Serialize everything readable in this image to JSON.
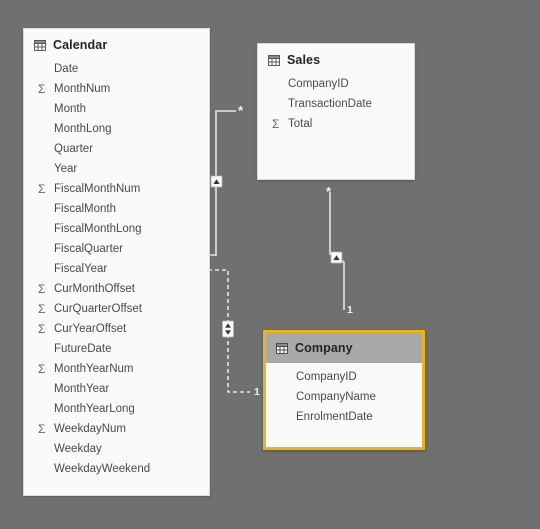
{
  "canvas": {
    "background": "#707070",
    "accent_selected": "#e9b418",
    "header_selected_bg": "#a8a8a8",
    "card_bg": "#fafafa",
    "line_color": "#e6e6e6"
  },
  "tables": [
    {
      "name": "Calendar",
      "icon": "table-icon",
      "selected": false,
      "fields": [
        {
          "name": "Date",
          "measure": false
        },
        {
          "name": "MonthNum",
          "measure": true
        },
        {
          "name": "Month",
          "measure": false
        },
        {
          "name": "MonthLong",
          "measure": false
        },
        {
          "name": "Quarter",
          "measure": false
        },
        {
          "name": "Year",
          "measure": false
        },
        {
          "name": "FiscalMonthNum",
          "measure": true
        },
        {
          "name": "FiscalMonth",
          "measure": false
        },
        {
          "name": "FiscalMonthLong",
          "measure": false
        },
        {
          "name": "FiscalQuarter",
          "measure": false
        },
        {
          "name": "FiscalYear",
          "measure": false
        },
        {
          "name": "CurMonthOffset",
          "measure": true
        },
        {
          "name": "CurQuarterOffset",
          "measure": true
        },
        {
          "name": "CurYearOffset",
          "measure": true
        },
        {
          "name": "FutureDate",
          "measure": false
        },
        {
          "name": "MonthYearNum",
          "measure": true
        },
        {
          "name": "MonthYear",
          "measure": false
        },
        {
          "name": "MonthYearLong",
          "measure": false
        },
        {
          "name": "WeekdayNum",
          "measure": true
        },
        {
          "name": "Weekday",
          "measure": false
        },
        {
          "name": "WeekdayWeekend",
          "measure": false
        }
      ]
    },
    {
      "name": "Sales",
      "icon": "table-icon",
      "selected": false,
      "fields": [
        {
          "name": "CompanyID",
          "measure": false
        },
        {
          "name": "TransactionDate",
          "measure": false
        },
        {
          "name": "Total",
          "measure": true
        }
      ]
    },
    {
      "name": "Company",
      "icon": "table-icon",
      "selected": true,
      "fields": [
        {
          "name": "CompanyID",
          "measure": false
        },
        {
          "name": "CompanyName",
          "measure": false
        },
        {
          "name": "EnrolmentDate",
          "measure": false
        }
      ]
    }
  ],
  "relationships": [
    {
      "id": "calendar-sales",
      "from": "Calendar",
      "to": "Sales",
      "from_cardinality": "1",
      "to_cardinality": "*",
      "active": true,
      "cross_filter": "single"
    },
    {
      "id": "sales-company",
      "from": "Sales",
      "to": "Company",
      "from_cardinality": "*",
      "to_cardinality": "1",
      "active": true,
      "cross_filter": "single"
    },
    {
      "id": "calendar-company",
      "from": "Calendar",
      "to": "Company",
      "from_cardinality": "1",
      "to_cardinality": "1",
      "active": false,
      "cross_filter": "both"
    }
  ],
  "markers": {
    "one": "1",
    "many": "*"
  }
}
